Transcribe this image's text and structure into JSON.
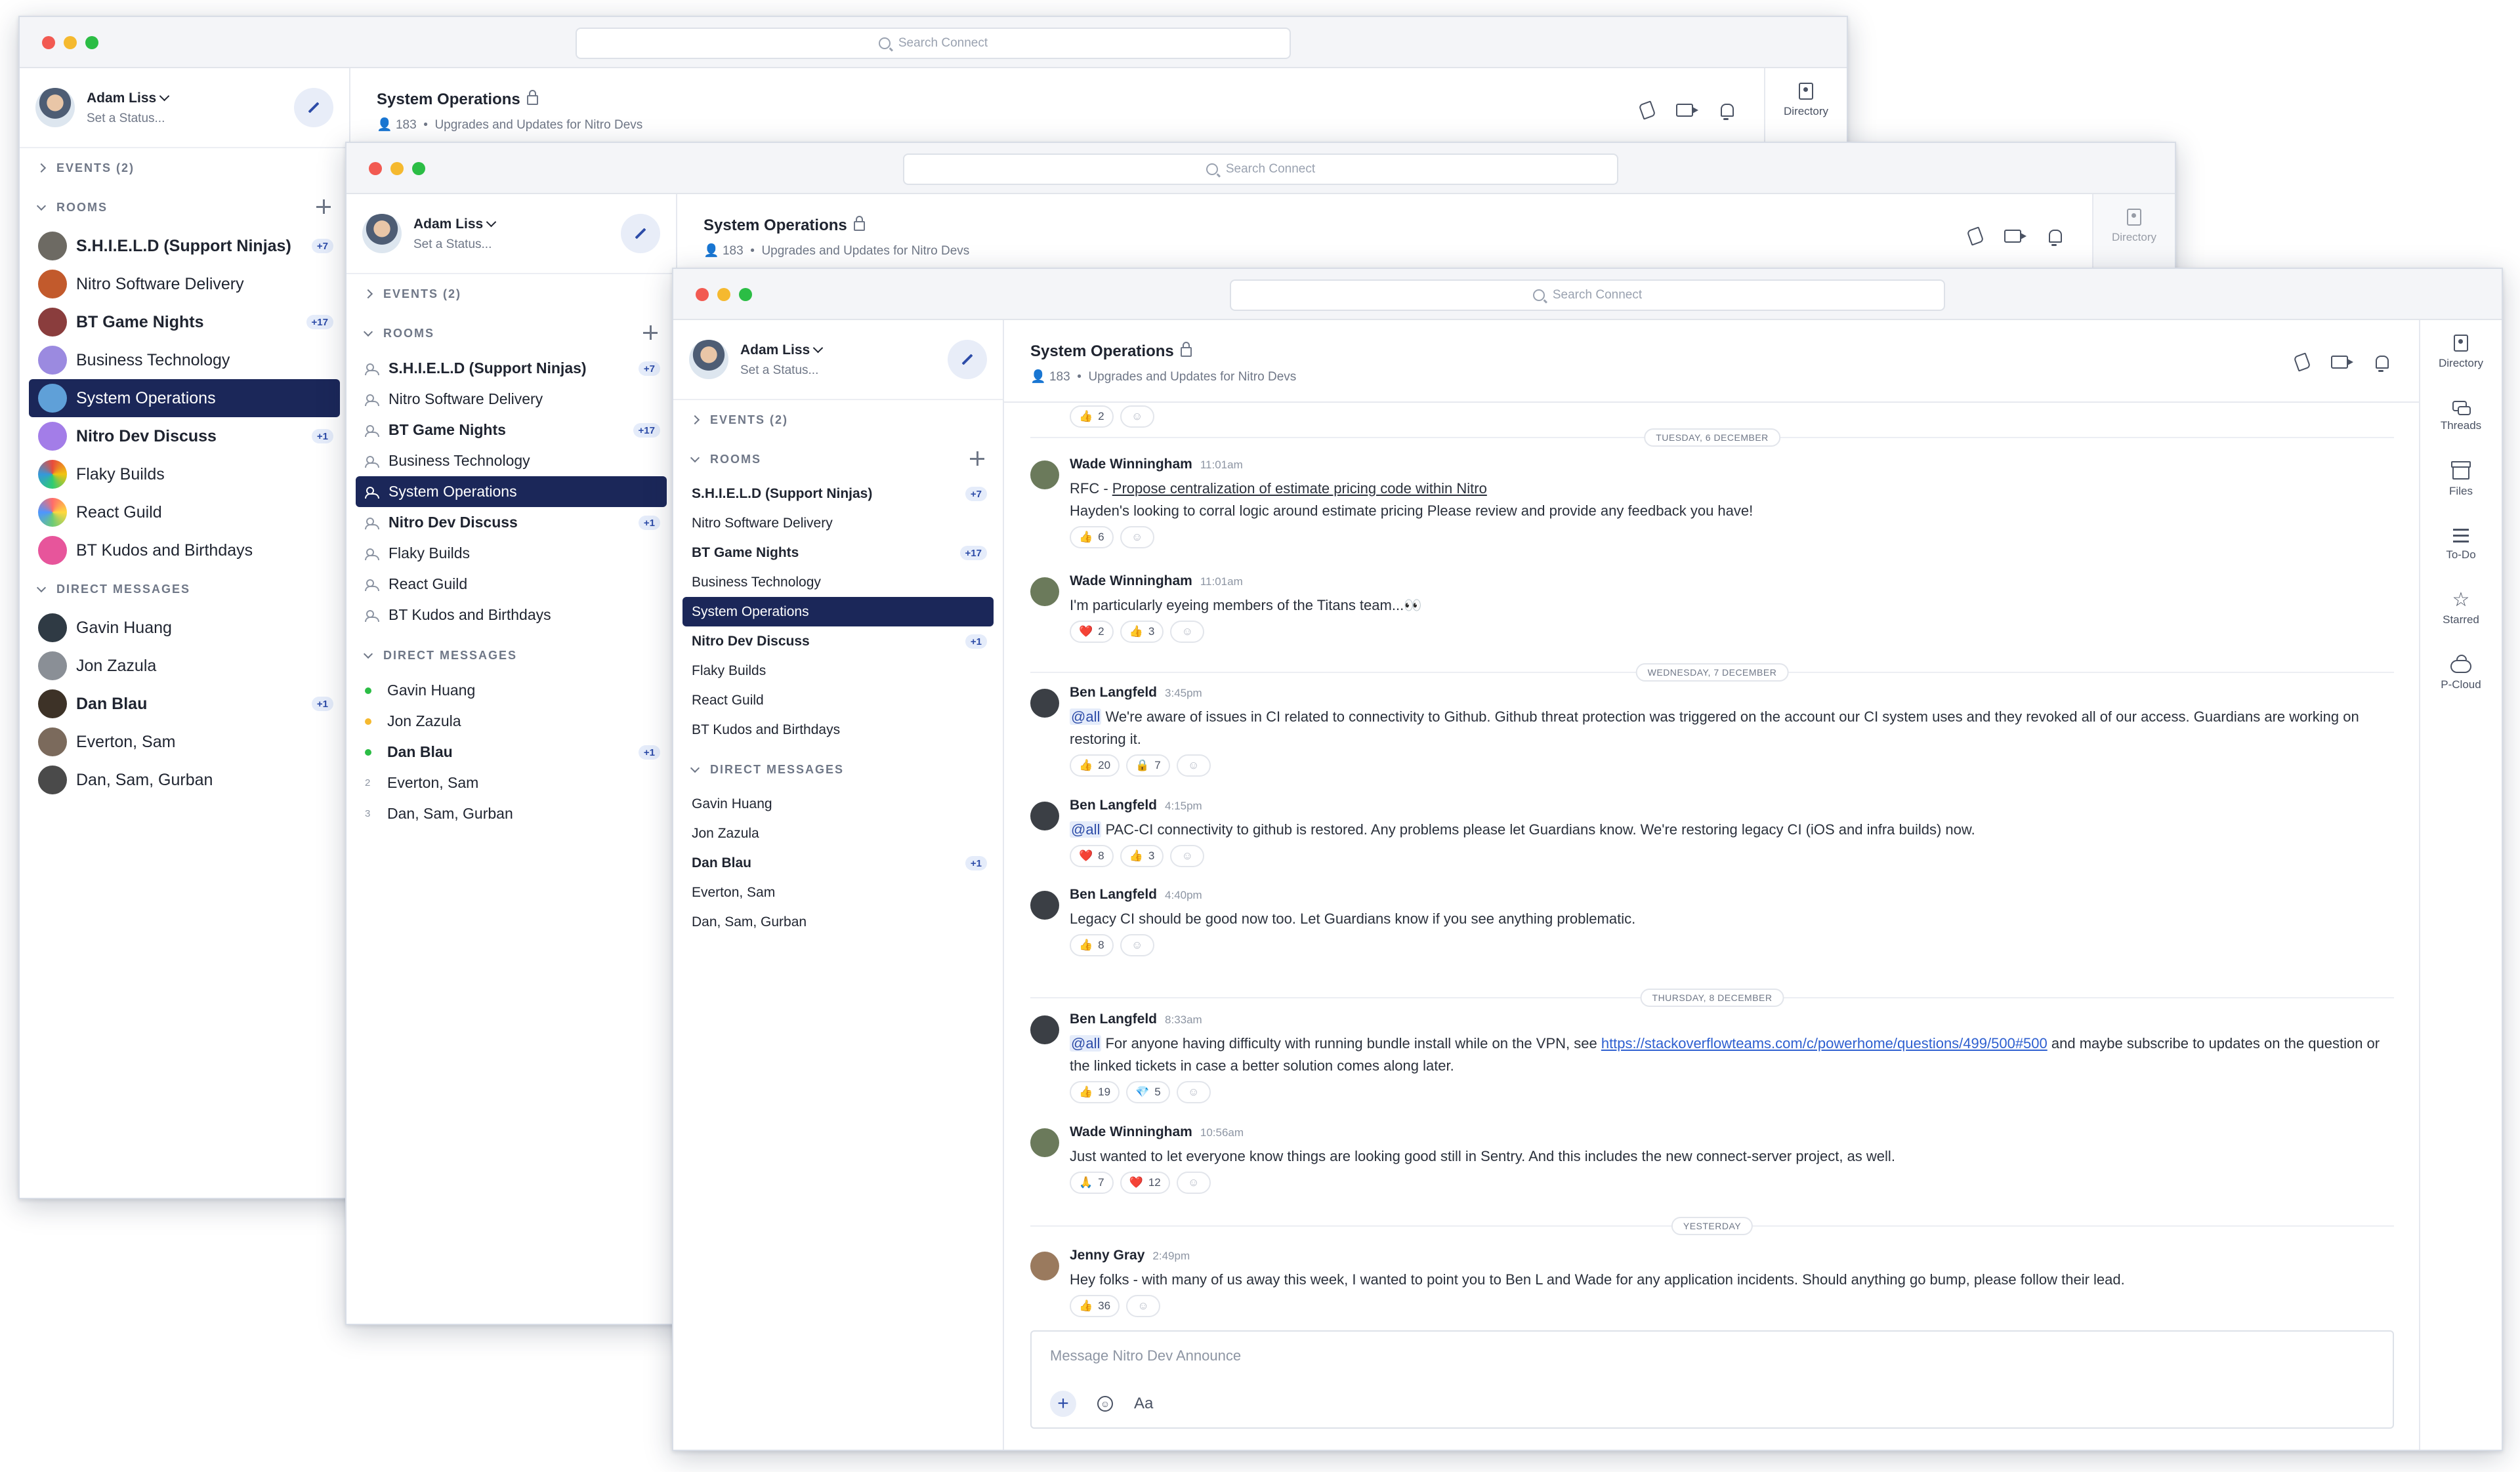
{
  "search": {
    "placeholder": "Search Connect"
  },
  "profile": {
    "name": "Adam Liss",
    "status": "Set a Status..."
  },
  "sections": {
    "events": "EVENTS (2)",
    "rooms": "ROOMS",
    "dms": "DIRECT MESSAGES"
  },
  "rooms": [
    {
      "label": "S.H.I.E.L.D (Support Ninjas)",
      "badge": "+7"
    },
    {
      "label": "Nitro Software Delivery",
      "badge": ""
    },
    {
      "label": "BT Game Nights",
      "badge": "+17"
    },
    {
      "label": "Business Technology",
      "badge": ""
    },
    {
      "label": "System Operations",
      "badge": ""
    },
    {
      "label": "Nitro Dev Discuss",
      "badge": "+1"
    },
    {
      "label": "Flaky Builds",
      "badge": ""
    },
    {
      "label": "React Guild",
      "badge": ""
    },
    {
      "label": "BT Kudos and Birthdays",
      "badge": ""
    }
  ],
  "dms": [
    {
      "label": "Gavin Huang",
      "badge": ""
    },
    {
      "label": "Jon Zazula",
      "badge": ""
    },
    {
      "label": "Dan Blau",
      "badge": "+1"
    },
    {
      "label": "Everton, Sam",
      "badge": "",
      "count": "2"
    },
    {
      "label": "Dan, Sam, Gurban",
      "badge": "",
      "count": "3"
    }
  ],
  "channel": {
    "title": "System Operations",
    "members": "183",
    "description": "Upgrades and Updates for Nitro Devs"
  },
  "rail": {
    "directory": "Directory",
    "threads": "Threads",
    "files": "Files",
    "todo": "To-Do",
    "starred": "Starred",
    "pcloud": "P-Cloud"
  },
  "messages": {
    "top_react": "2",
    "date1": "TUESDAY, 6 DECEMBER",
    "date2": "WEDNESDAY, 7 DECEMBER",
    "date3": "THURSDAY, 8 DECEMBER",
    "date4": "YESTERDAY",
    "m1": {
      "author": "Wade Winningham",
      "time": "11:01am",
      "prefix": "RFC - ",
      "link_text": "Propose centralization of estimate pricing code within Nitro",
      "line2": "Hayden's looking to corral logic around estimate pricing Please review and provide any feedback you have!",
      "r1": "6"
    },
    "m2": {
      "author": "Wade Winningham",
      "time": "11:01am",
      "text": "I'm particularly eyeing members of the Titans team...👀",
      "r1": "2",
      "r2": "3"
    },
    "m3": {
      "author": "Ben Langfeld",
      "time": "3:45pm",
      "mention": "@all",
      "text": " We're aware of issues in CI related to connectivity to Github. Github threat protection was triggered on the account our CI system uses and they revoked all of our access. Guardians are working on restoring it.",
      "r1": "20",
      "r2": "7"
    },
    "m4": {
      "author": "Ben Langfeld",
      "time": "4:15pm",
      "mention": "@all",
      "text": " PAC-CI connectivity to github is restored. Any problems please let Guardians know. We're restoring legacy CI (iOS and infra builds) now.",
      "r1": "8",
      "r2": "3"
    },
    "m5": {
      "author": "Ben Langfeld",
      "time": "4:40pm",
      "text": "Legacy CI should be good now too. Let Guardians know if you see anything problematic.",
      "r1": "8"
    },
    "m6": {
      "author": "Ben Langfeld",
      "time": "8:33am",
      "mention": "@all",
      "text_a": " For anyone having difficulty with running bundle install while on the VPN, see ",
      "link": "https://stackoverflowteams.com/c/powerhome/questions/499/500#500",
      "text_b": " and maybe subscribe to updates on the question or the linked tickets in case a better solution comes along later.",
      "r1": "19",
      "r2": "5"
    },
    "m7": {
      "author": "Wade Winningham",
      "time": "10:56am",
      "text": "Just wanted to let everyone know things are looking good still in Sentry. And this includes the new connect-server project, as well.",
      "r1": "7",
      "r2": "12"
    },
    "m8": {
      "author": "Jenny Gray",
      "time": "2:49pm",
      "text": "Hey folks - with many of us away this week, I wanted to point you to Ben L and Wade for any application incidents. Should anything go bump, please follow their lead.",
      "r1": "36"
    }
  },
  "composer": {
    "placeholder": "Message Nitro Dev Announce",
    "font_label": "Aa"
  },
  "emojis": {
    "thumbs": "👍",
    "heart": "❤️",
    "lock": "🔒",
    "gem": "💎",
    "pray": "🙏"
  }
}
